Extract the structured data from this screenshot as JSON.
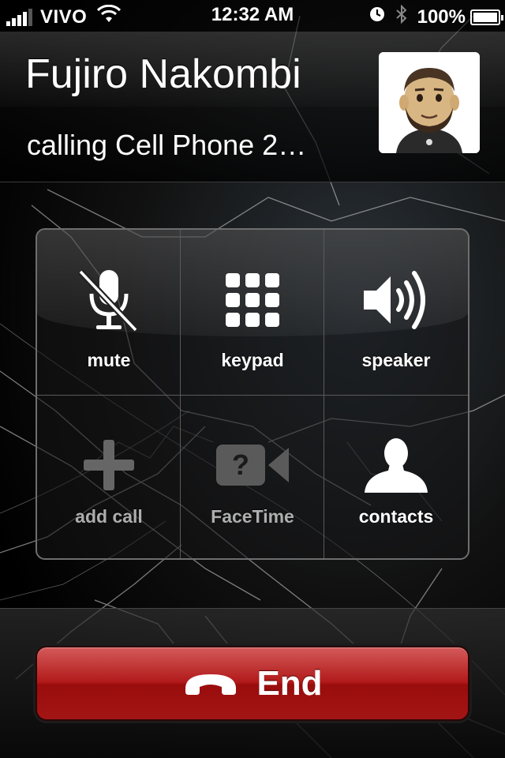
{
  "status_bar": {
    "carrier": "VIVO",
    "time": "12:32 AM",
    "battery": "100%",
    "signal_icon": "signal-bars-icon",
    "wifi_icon": "wifi-icon",
    "alarm_icon": "alarm-clock-icon",
    "bluetooth_icon": "bluetooth-icon",
    "battery_icon": "battery-charging-icon"
  },
  "caller": {
    "name": "Fujiro Nakombi",
    "status": "calling Cell Phone 2…",
    "avatar_icon": "caller-avatar"
  },
  "controls": [
    {
      "label": "mute",
      "icon": "mute-microphone-icon",
      "enabled": true
    },
    {
      "label": "keypad",
      "icon": "keypad-grid-icon",
      "enabled": true
    },
    {
      "label": "speaker",
      "icon": "speaker-icon",
      "enabled": true
    },
    {
      "label": "add call",
      "icon": "plus-icon",
      "enabled": false
    },
    {
      "label": "FaceTime",
      "icon": "facetime-camera-icon",
      "enabled": false
    },
    {
      "label": "contacts",
      "icon": "contact-person-icon",
      "enabled": true
    }
  ],
  "end_button": {
    "label": "End",
    "icon": "phone-hangup-icon",
    "color": "#b21a1a"
  }
}
